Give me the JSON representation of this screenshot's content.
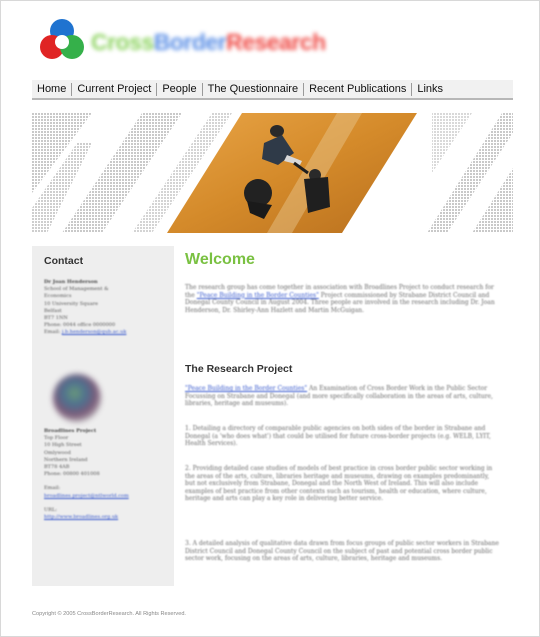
{
  "header": {
    "brand_part1": "Cross",
    "brand_part2": "Border",
    "brand_part3": "Research"
  },
  "nav": {
    "items": [
      {
        "label": "Home"
      },
      {
        "label": "Current Project"
      },
      {
        "label": "People"
      },
      {
        "label": "The Questionnaire"
      },
      {
        "label": "Recent Publications"
      },
      {
        "label": "Links"
      }
    ]
  },
  "sidebar": {
    "title": "Contact",
    "contact_name": "Dr Joan Henderson",
    "contact_lines": [
      "School of Management &",
      "Economics",
      "10 University Square",
      "Belfast",
      "BT7 1NN",
      "Phone: 0044 office 0000000",
      "Email:"
    ],
    "contact_email": "j.b.henderson@qub.ac.uk",
    "org_name": "Broadlines Project",
    "org_lines": [
      "Top Floor",
      "10 High Street",
      "Omlywood",
      "Northern Ireland",
      "BT78 4AB",
      "Phone: 00800 401008"
    ],
    "org_email_label": "Email:",
    "org_email": "broadlines.project@ntlworld.com",
    "url_label": "URL:",
    "url": "http://www.broadlines.org.uk"
  },
  "main": {
    "welcome": "Welcome",
    "intro_before": "The research group has come together in association with Broadlines Project to conduct research for the",
    "intro_link": "\"Peace Building in the Border Counties\"",
    "intro_after": "Project commissioned by Strabane District Council and Donegal County Council in August 2004. Three people are involved in the research including Dr. Joan Henderson, Dr. Shirley-Ann Hazlett and Martin McGuigan.",
    "subhead": "The Research Project",
    "rp_link": "\"Peace Building in the Border Counties\"",
    "rp_after": "An Examination of Cross Border Work in the Public Sector Focussing on Strabane and Donegal (and more specifically collaboration in the areas of arts, culture, libraries, heritage and museums).",
    "item1": "1. Detailing a directory of comparable public agencies on both sides of the border in Strabane and Donegal (a 'who does what') that could be utilised for future cross-border projects (e.g. WELB, LYIT, Health Services).",
    "item2": "2. Providing detailed case studies of models of best practice in cross border public sector working in the areas of the arts, culture, libraries heritage and museums, drawing on examples predominantly, but not exclusively from Strabane, Donegal and the North West of Ireland. This will also include examples of best practice from other contexts such as tourism, health or education, where culture, heritage and arts can play a key role in delivering better service.",
    "item3": "3. A detailed analysis of qualitative data drawn from focus groups of public sector workers in Strabane District Council and Donegal County Council on the subject of past and potential cross border public sector work, focusing on the areas of arts, culture, libraries, heritage and museums."
  },
  "footer": {
    "copyright": "Copyright © 2005 CrossBorderResearch. All Rights Reserved."
  },
  "colors": {
    "welcome_green": "#7ac142",
    "banner_orange": "#d8902f",
    "logo_blue": "#1f73d0",
    "logo_red": "#e02424",
    "logo_green": "#35b04a"
  }
}
